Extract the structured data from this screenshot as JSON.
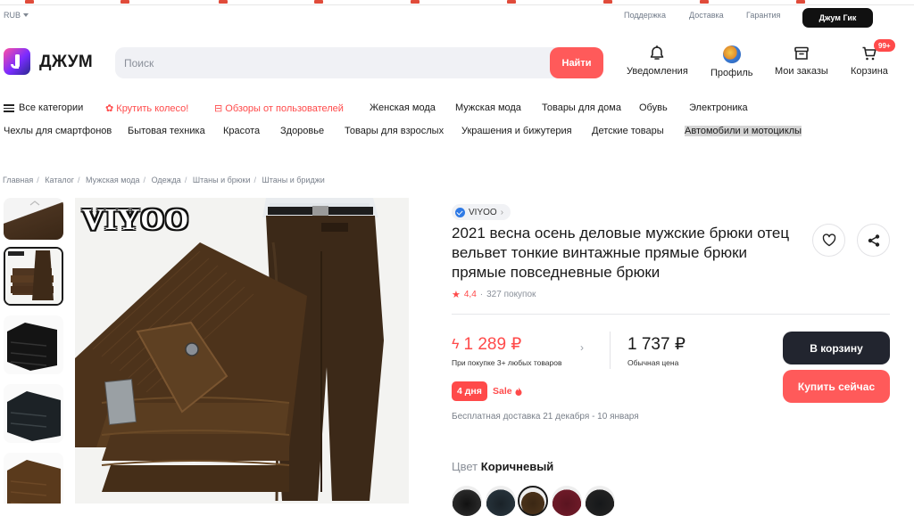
{
  "topbar": {
    "currency": "RUB",
    "links": [
      "Поддержка",
      "Доставка",
      "Гарантия"
    ],
    "gik_button": "Джум Гик"
  },
  "header": {
    "brand": "ДЖУМ",
    "search_placeholder": "Поиск",
    "search_button": "Найти",
    "nav": {
      "notifications": "Уведомления",
      "profile": "Профиль",
      "orders": "Мои заказы",
      "cart": "Корзина",
      "cart_badge": "99+"
    }
  },
  "categories": {
    "row1": [
      "Все категории",
      "Крутить колесо!",
      "Обзоры от пользователей",
      "Женская мода",
      "Мужская мода",
      "Товары для дома",
      "Обувь",
      "Электроника"
    ],
    "row2": [
      "Чехлы для смартфонов",
      "Бытовая техника",
      "Красота",
      "Здоровье",
      "Товары для взрослых",
      "Украшения и бижутерия",
      "Детские товары",
      "Автомобили и мотоциклы"
    ]
  },
  "breadcrumb": [
    "Главная",
    "Каталог",
    "Мужская мода",
    "Одежда",
    "Штаны и брюки",
    "Штаны и бриджи"
  ],
  "gallery": {
    "watermark": "VIYOO"
  },
  "product": {
    "seller": "VIYOO",
    "title": "2021 весна осень деловые мужские брюки отец вельвет тонкие винтажные прямые брюки прямые повседневные брюки",
    "rating": "4,4",
    "purchases": "327 покупок",
    "promo_price": "1 289 ₽",
    "promo_note": "При покупке 3+ любых товаров",
    "regular_price": "1 737 ₽",
    "regular_note": "Обычная цена",
    "add_to_cart": "В корзину",
    "buy_now": "Купить сейчас",
    "days_badge": "4 дня",
    "sale_label": "Sale",
    "delivery": "Бесплатная доставка 21 декабря - 10 января",
    "color_label": "Цвет",
    "color_value": "Коричневый"
  },
  "colors": {
    "accent": "#ff5a5a",
    "dark_button": "#22252f",
    "verified": "#2f7ae5"
  }
}
